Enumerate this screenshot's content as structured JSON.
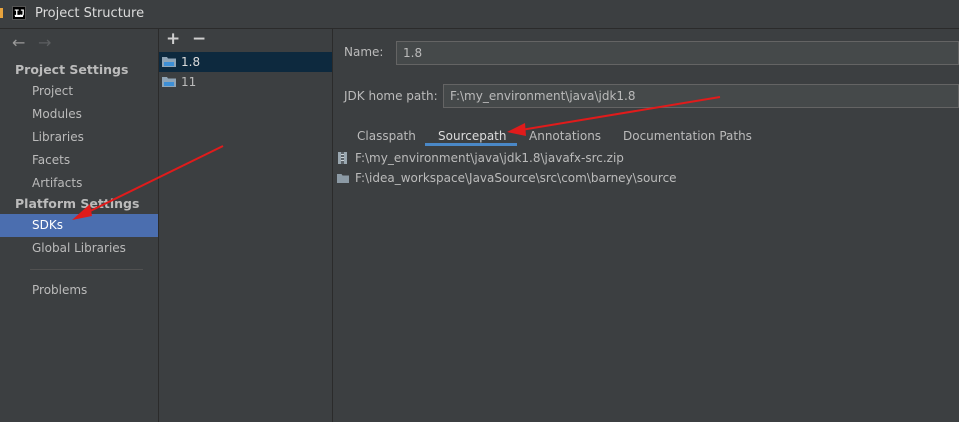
{
  "window": {
    "title": "Project Structure",
    "icon": "intellij-idea-icon"
  },
  "navigation": {
    "back_icon": "←",
    "forward_icon": "→"
  },
  "sidebar": {
    "project_settings_header": "Project Settings",
    "project_settings_items": [
      "Project",
      "Modules",
      "Libraries",
      "Facets",
      "Artifacts"
    ],
    "platform_settings_header": "Platform Settings",
    "platform_settings_items": [
      "SDKs",
      "Global Libraries"
    ],
    "selected_item": "SDKs",
    "problems_label": "Problems"
  },
  "sdk_toolbar": {
    "add_label": "+",
    "remove_label": "−"
  },
  "sdk_list": [
    {
      "label": "1.8",
      "selected": true
    },
    {
      "label": "11",
      "selected": false
    }
  ],
  "form": {
    "name_label": "Name:",
    "name_value": "1.8",
    "jdk_home_label": "JDK home path:",
    "jdk_home_value": "F:\\my_environment\\java\\jdk1.8"
  },
  "tabs": [
    {
      "label": "Classpath",
      "active": false
    },
    {
      "label": "Sourcepath",
      "active": true
    },
    {
      "label": "Annotations",
      "active": false
    },
    {
      "label": "Documentation Paths",
      "active": false
    }
  ],
  "sourcepaths": [
    {
      "path": "F:\\my_environment\\java\\jdk1.8\\javafx-src.zip",
      "icon": "archive-icon"
    },
    {
      "path": "F:\\idea_workspace\\JavaSource\\src\\com\\barney\\source",
      "icon": "folder-icon"
    }
  ],
  "colors": {
    "background": "#3c3f41",
    "selection_blue": "#4b6eaf",
    "list_selection": "#0d293e",
    "tab_underline": "#4a88c7",
    "annotation_arrow": "#e01b1b"
  }
}
